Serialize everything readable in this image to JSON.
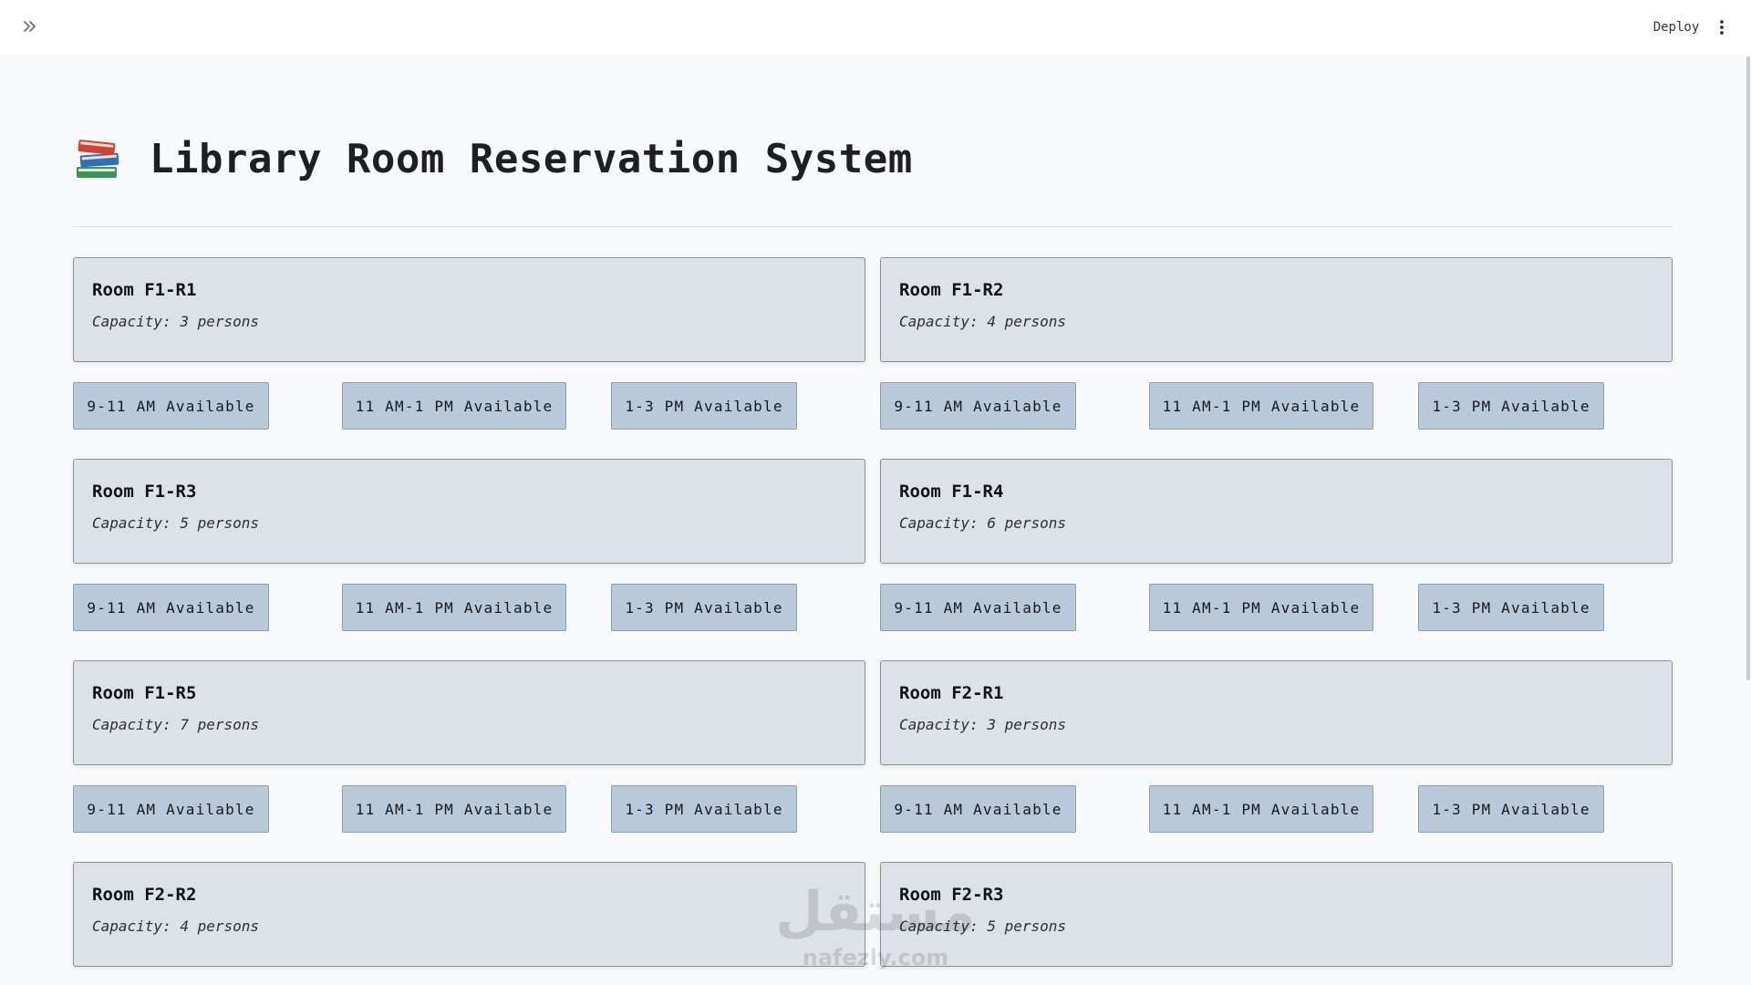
{
  "header": {
    "deploy_label": "Deploy"
  },
  "page": {
    "title": "Library Room Reservation System",
    "title_icon": "books-icon"
  },
  "rooms": [
    {
      "name": "Room F1-R1",
      "capacity": "Capacity: 3 persons",
      "slots": [
        "9-11 AM Available",
        "11 AM-1 PM Available",
        "1-3 PM Available"
      ]
    },
    {
      "name": "Room F1-R2",
      "capacity": "Capacity: 4 persons",
      "slots": [
        "9-11 AM Available",
        "11 AM-1 PM Available",
        "1-3 PM Available"
      ]
    },
    {
      "name": "Room F1-R3",
      "capacity": "Capacity: 5 persons",
      "slots": [
        "9-11 AM Available",
        "11 AM-1 PM Available",
        "1-3 PM Available"
      ]
    },
    {
      "name": "Room F1-R4",
      "capacity": "Capacity: 6 persons",
      "slots": [
        "9-11 AM Available",
        "11 AM-1 PM Available",
        "1-3 PM Available"
      ]
    },
    {
      "name": "Room F1-R5",
      "capacity": "Capacity: 7 persons",
      "slots": [
        "9-11 AM Available",
        "11 AM-1 PM Available",
        "1-3 PM Available"
      ]
    },
    {
      "name": "Room F2-R1",
      "capacity": "Capacity: 3 persons",
      "slots": [
        "9-11 AM Available",
        "11 AM-1 PM Available",
        "1-3 PM Available"
      ]
    },
    {
      "name": "Room F2-R2",
      "capacity": "Capacity: 4 persons"
    },
    {
      "name": "Room F2-R3",
      "capacity": "Capacity: 5 persons"
    }
  ],
  "watermark": {
    "text_arabic": "مستقل",
    "text_latin": "nafezly.com"
  },
  "colors": {
    "card_bg": "#dde1e8",
    "slot_bg": "#b9c9dc",
    "page_bg": "#f8f9fb"
  }
}
